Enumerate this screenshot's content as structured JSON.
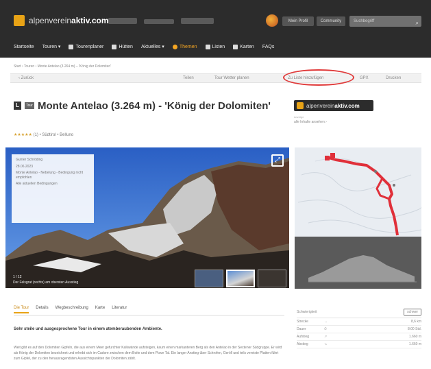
{
  "header": {
    "logo": {
      "prefix": "alpenverein",
      "bold": "aktiv.com"
    },
    "user_btn": "Mein Profil",
    "community_btn": "Community",
    "search_placeholder": "Suchbegriff",
    "nav": [
      {
        "label": "Startseite",
        "icon": "none"
      },
      {
        "label": "Touren ▾",
        "icon": "none"
      },
      {
        "label": "Tourenplaner",
        "icon": "planner-icon"
      },
      {
        "label": "Hütten",
        "icon": "hut-icon"
      },
      {
        "label": "Aktuelles ▾",
        "icon": "none"
      },
      {
        "label": "Themen",
        "icon": "sun-icon",
        "active": true
      },
      {
        "label": "Listen",
        "icon": "list-icon"
      },
      {
        "label": "Karten",
        "icon": "map-icon"
      },
      {
        "label": "FAQs",
        "icon": "none"
      }
    ]
  },
  "breadcrumb": "Start › Touren › Monte Antelao (3.264 m) – 'König der Dolomiten'",
  "toolbar": {
    "back": "‹ Zurück",
    "items": [
      "Teilen",
      "Tour Wetter planen",
      "Zu Liste hinzufügen",
      "GPX",
      "Drucken"
    ]
  },
  "tour": {
    "badge": "L",
    "badge2": "Tour",
    "title": "Monte Antelao (3.264 m) - 'König der Dolomiten'",
    "stars": "★★★★★",
    "rating_rest": "(1) • Südtirol • Belluno"
  },
  "ad": {
    "label": "Anzeige",
    "text": "alle Inhalte ansehen ›",
    "logo_prefix": "alpenverein",
    "logo_bold": "aktiv.com"
  },
  "photo": {
    "conditions": [
      "Gunter Schröding",
      "28.06.2023",
      "Monte Antelao - Nebelung - Bedingung nicht empfohlen",
      "Alle aktuellen Bedingungen"
    ],
    "counter": "1 / 12",
    "caption": "Der Felsgrat (rechts) am obersten Ausstieg"
  },
  "tabs": [
    "Die Tour",
    "Details",
    "Wegbeschreibung",
    "Karte",
    "Literatur"
  ],
  "content": {
    "subtitle": "Sehr steile und ausgesprochene Tour in einem atemberaubenden Ambiente.",
    "body": "Weit gibt es auf den Dolomiten Gipfeln, die aus einem Meer gefurchter Kalkwände aufsteigen, kaum einen markanteren Berg als den Antelao in der Sextener Südgruppe. Er wird als König der Dolomiten bezeichnet und erhebt sich im Cadore zwischen dem Boite und dem Piave Tal. Ein langer Anstieg über Schrofen, Geröll und teils vereiste Platten führt zum Gipfel, der zu den herausragendsten Aussichtspunkten der Dolomiten zählt."
  },
  "facts": {
    "head": "Schwierigkeit",
    "badge": "schwer",
    "rows": [
      {
        "k": "Strecke",
        "i": "↔",
        "v": "8,6 km"
      },
      {
        "k": "Dauer",
        "i": "⏱",
        "v": "8:00 Std."
      },
      {
        "k": "Aufstieg",
        "i": "↗",
        "v": "1.660 m"
      },
      {
        "k": "Abstieg",
        "i": "↘",
        "v": "1.660 m"
      }
    ]
  },
  "colors": {
    "accent": "#e8a316",
    "highlight": "#e03a3a",
    "header": "#2c2c2c"
  }
}
